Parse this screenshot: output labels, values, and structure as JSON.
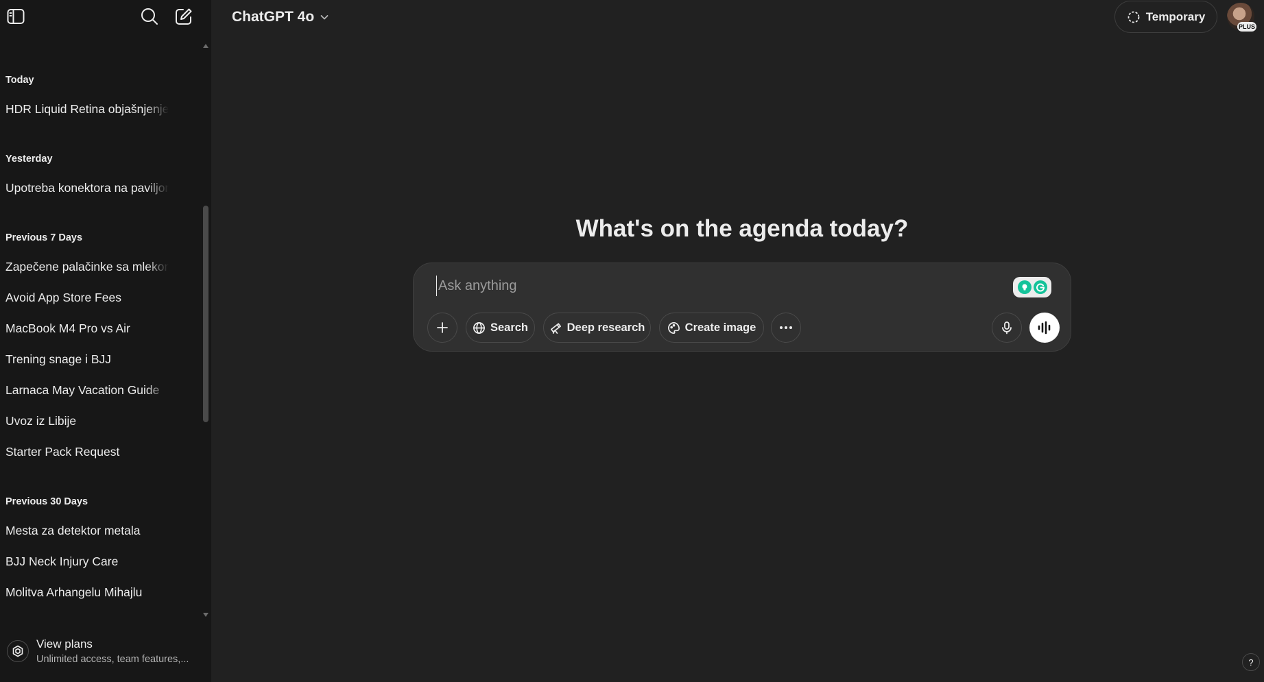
{
  "sidebar": {
    "toggle_icon": "sidebar-toggle-icon",
    "search_icon": "search-icon",
    "new_chat_icon": "new-chat-icon",
    "groups": [
      {
        "label": "Today",
        "items": [
          "HDR Liquid Retina objašnjenje"
        ]
      },
      {
        "label": "Yesterday",
        "items": [
          "Upotreba konektora na paviljonu"
        ]
      },
      {
        "label": "Previous 7 Days",
        "items": [
          "Zapečene palačinke sa mlekom",
          "Avoid App Store Fees",
          "MacBook M4 Pro vs Air",
          "Trening snage i BJJ",
          "Larnaca May Vacation Guide",
          "Uvoz iz Libije",
          "Starter Pack Request"
        ]
      },
      {
        "label": "Previous 30 Days",
        "items": [
          "Mesta za detektor metala",
          "BJJ Neck Injury Care",
          "Molitva Arhangelu Mihajlu"
        ]
      }
    ],
    "upgrade": {
      "title": "View plans",
      "subtitle": "Unlimited access, team features,..."
    }
  },
  "header": {
    "model": "ChatGPT 4o",
    "temporary_label": "Temporary",
    "plan_badge": "PLUS"
  },
  "main": {
    "headline": "What's on the agenda today?",
    "composer": {
      "placeholder": "Ask anything",
      "tools": {
        "search": "Search",
        "deep_research": "Deep research",
        "create_image": "Create image"
      }
    }
  },
  "help_label": "?",
  "colors": {
    "background": "#212121",
    "sidebar": "#171717",
    "composer": "#303030",
    "text": "#ececec",
    "grammarly_green": "#15c39a"
  }
}
